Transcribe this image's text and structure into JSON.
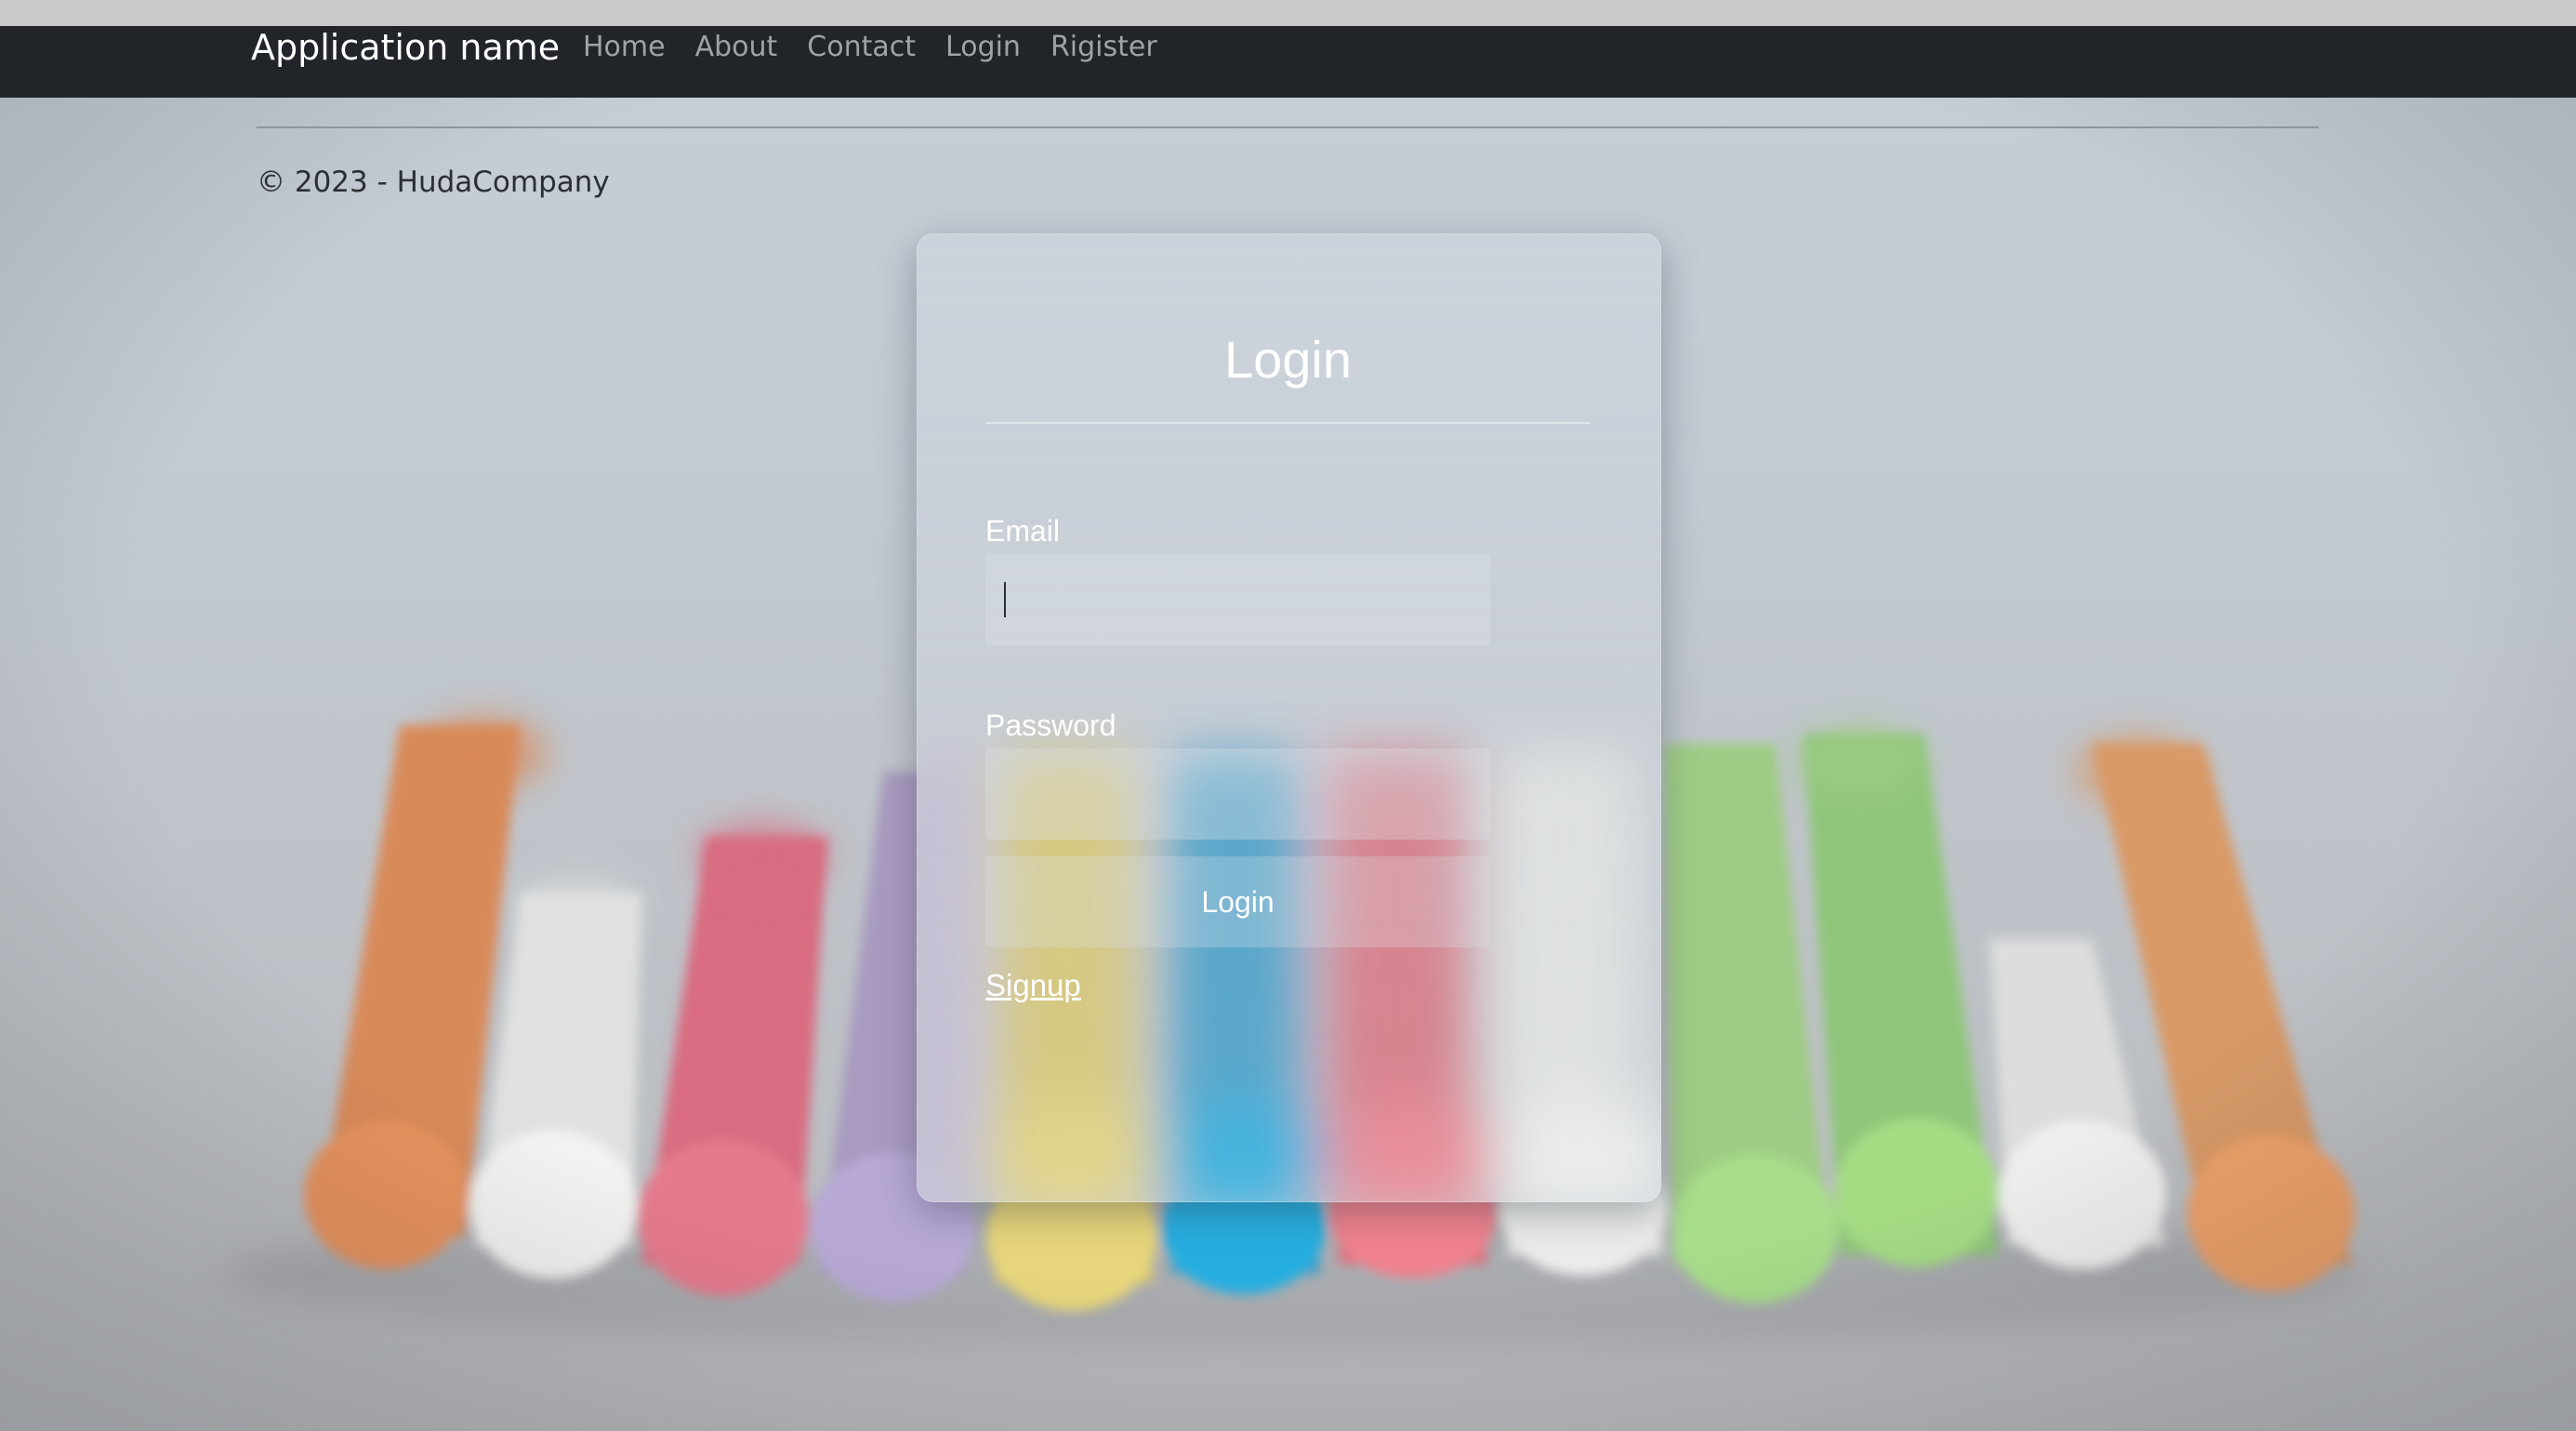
{
  "navbar": {
    "brand": "Application name",
    "links": [
      {
        "label": "Home"
      },
      {
        "label": "About"
      },
      {
        "label": "Contact"
      },
      {
        "label": "Login"
      },
      {
        "label": "Rigister"
      }
    ]
  },
  "footer": {
    "copyright": "© 2023 - HudaCompany"
  },
  "login_card": {
    "title": "Login",
    "email_label": "Email",
    "email_value": "",
    "password_label": "Password",
    "password_value": "",
    "submit_label": "Login",
    "signup_label": "Signup"
  },
  "colors": {
    "navbar_bg": "#212529",
    "nav_link": "#9ea3a8",
    "card_text": "#ffffff"
  }
}
